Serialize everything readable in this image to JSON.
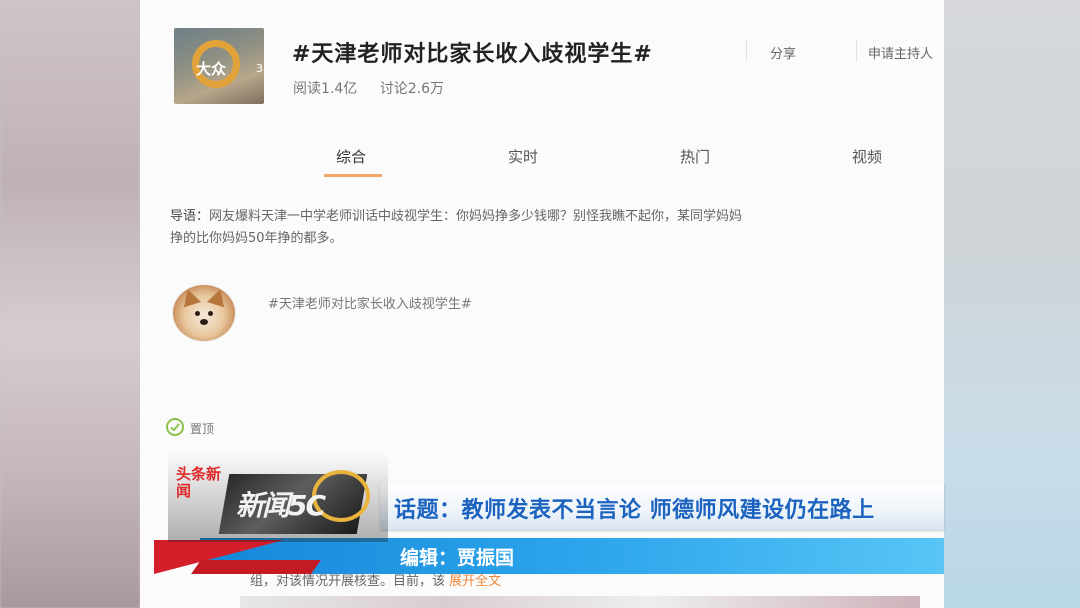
{
  "topic": {
    "thumb_logo_text": "大众",
    "thumb_number": "3",
    "title": "#天津老师对比家长收入歧视学生#",
    "reads": "阅读1.4亿",
    "discussions": "讨论2.6万",
    "share_label": "分享",
    "host_label": "申请主持人"
  },
  "tabs": [
    {
      "label": "综合"
    },
    {
      "label": "实时"
    },
    {
      "label": "热门"
    },
    {
      "label": "视频"
    }
  ],
  "lead": {
    "label": "导语：",
    "text": "网友爆料天津一中学老师训话中歧视学生：你妈妈挣多少钱哪？别怪我瞧不起你，某同学妈妈",
    "text_line2": "挣的比你妈妈50年挣的都多。"
  },
  "post": {
    "tag": "#天津老师对比家长收入歧视学生#"
  },
  "pin": {
    "label": "置顶"
  },
  "feed_tail": {
    "text": "组，对该情况开展核查。目前，该",
    "expand": "展开全文"
  },
  "overlay": {
    "logo_red": "头条新闻",
    "logo_main": "新闻5C",
    "topic_bar": "话题：教师发表不当言论 师德师风建设仍在路上",
    "editor_bar": "编辑：贾振国"
  },
  "colors": {
    "accent_orange": "#f3a86a",
    "topic_blue": "#1c63c0",
    "editor_bar_blue": "#1687d9",
    "overlay_red": "#d41f2a"
  }
}
